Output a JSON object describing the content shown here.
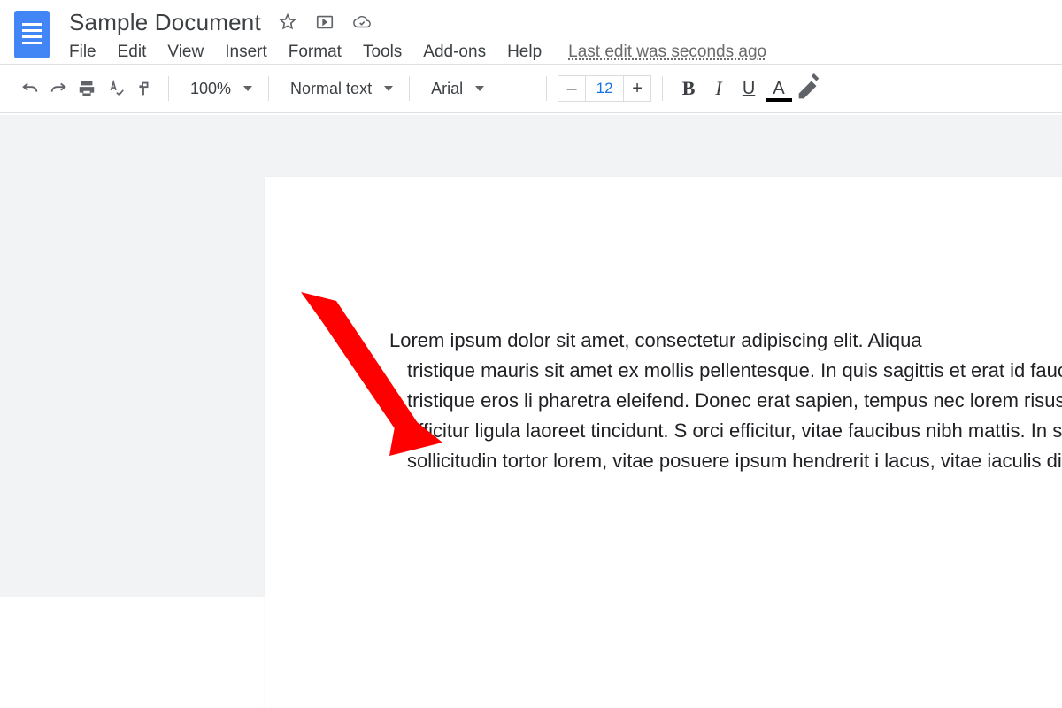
{
  "header": {
    "title": "Sample Document",
    "menus": [
      "File",
      "Edit",
      "View",
      "Insert",
      "Format",
      "Tools",
      "Add-ons",
      "Help"
    ],
    "last_edit": "Last edit was seconds ago"
  },
  "toolbar": {
    "zoom": "100%",
    "style": "Normal text",
    "font": "Arial",
    "font_size_minus": "–",
    "font_size": "12",
    "font_size_plus": "+",
    "bold": "B",
    "italic": "I",
    "underline": "U",
    "text_color": "A"
  },
  "document": {
    "first_line": "Lorem ipsum dolor sit amet, consectetur adipiscing elit. Aliqua",
    "body_rest": "tristique mauris sit amet ex mollis pellentesque. In quis sagittis et erat id faucibus. Suspendisse tristique eros li pharetra eleifend. Donec erat sapien, tempus nec lorem risus. Aenean pretium efficitur ligula laoreet tincidunt. S orci efficitur, vitae faucibus nibh mattis. In sit amet mole sollicitudin tortor lorem, vitae posuere ipsum hendrerit i lacus, vitae iaculis diam."
  }
}
